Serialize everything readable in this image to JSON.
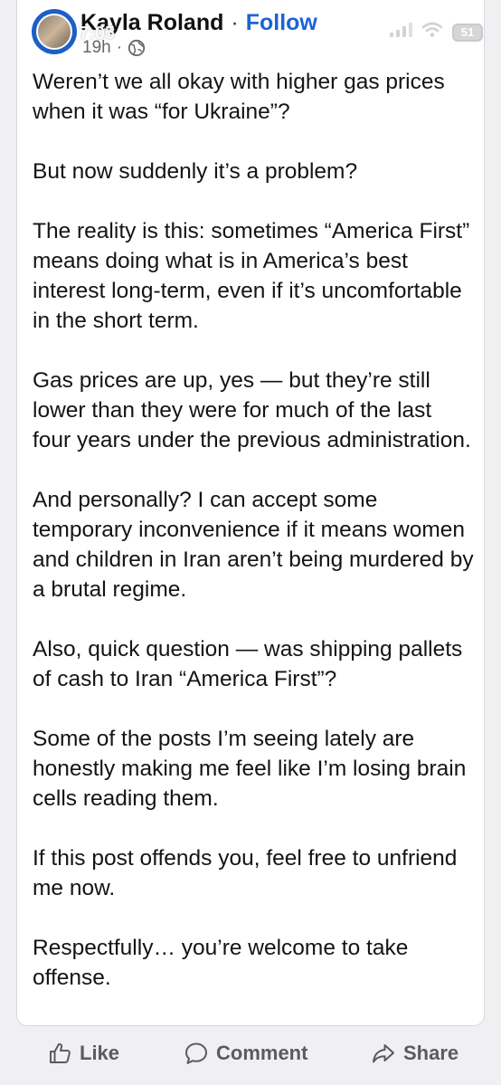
{
  "post": {
    "author": "Kayla Roland",
    "separator": "·",
    "follow_label": "Follow",
    "time_ago": "19h",
    "meta_separator": "·",
    "audience_icon": "globe-icon",
    "paragraphs": [
      "Weren’t we all okay with higher gas prices when it was “for Ukraine”?",
      "But now suddenly it’s a problem?",
      "The reality is this: sometimes “America First” means doing what is in America’s best interest long-term, even if it’s uncomfortable in the short term.",
      "Gas prices are up, yes — but they’re still lower than they were for much of the last four years under the previous administration.",
      "And personally? I can accept some temporary inconvenience if it means women and children in Iran aren’t being murdered by a brutal regime.",
      "Also, quick question — was shipping pallets of cash to Iran “America First”?",
      "Some of the posts I’m seeing lately are honestly making me feel like I’m losing brain cells reading them.",
      "If this post offends you, feel free to unfriend me now.",
      "Respectfully… you’re welcome to take offense."
    ]
  },
  "status_bar": {
    "time": "7:05",
    "battery": "51",
    "icons": [
      "signal-icon",
      "wifi-icon",
      "battery-icon"
    ]
  },
  "actions": {
    "like_label": "Like",
    "comment_label": "Comment",
    "share_label": "Share",
    "icons": [
      "thumbs-up-icon",
      "comment-bubble-icon",
      "share-arrow-icon"
    ]
  },
  "colors": {
    "link": "#1d63d6",
    "text": "#141414",
    "secondary": "#5b5b5f",
    "background": "#f0f0f2",
    "card": "#ffffff",
    "avatar_ring": "#1b5fc7"
  }
}
